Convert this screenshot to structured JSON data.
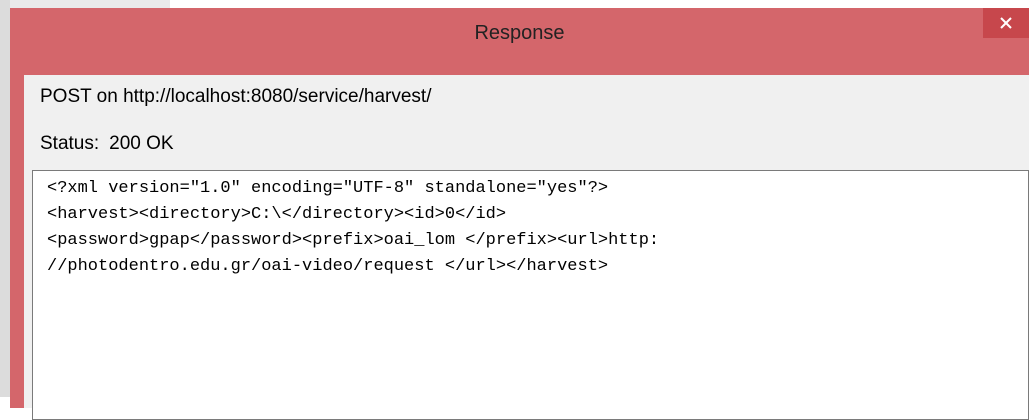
{
  "window": {
    "title": "Response",
    "close_label": "✕"
  },
  "request": {
    "line": "POST on http://localhost:8080/service/harvest/"
  },
  "status": {
    "label": "Status:",
    "value": "200 OK"
  },
  "response_body": {
    "lines": [
      "<?xml version=\"1.0\" encoding=\"UTF-8\" standalone=\"yes\"?>",
      "<harvest><directory>C:\\</directory><id>0</id>",
      "<password>gpap</password><prefix>oai_lom </prefix><url>http:",
      "//photodentro.edu.gr/oai-video/request </url></harvest>"
    ]
  },
  "colors": {
    "frame": "#d4666b",
    "close_button": "#c7474c",
    "client": "#f0f0f0"
  }
}
